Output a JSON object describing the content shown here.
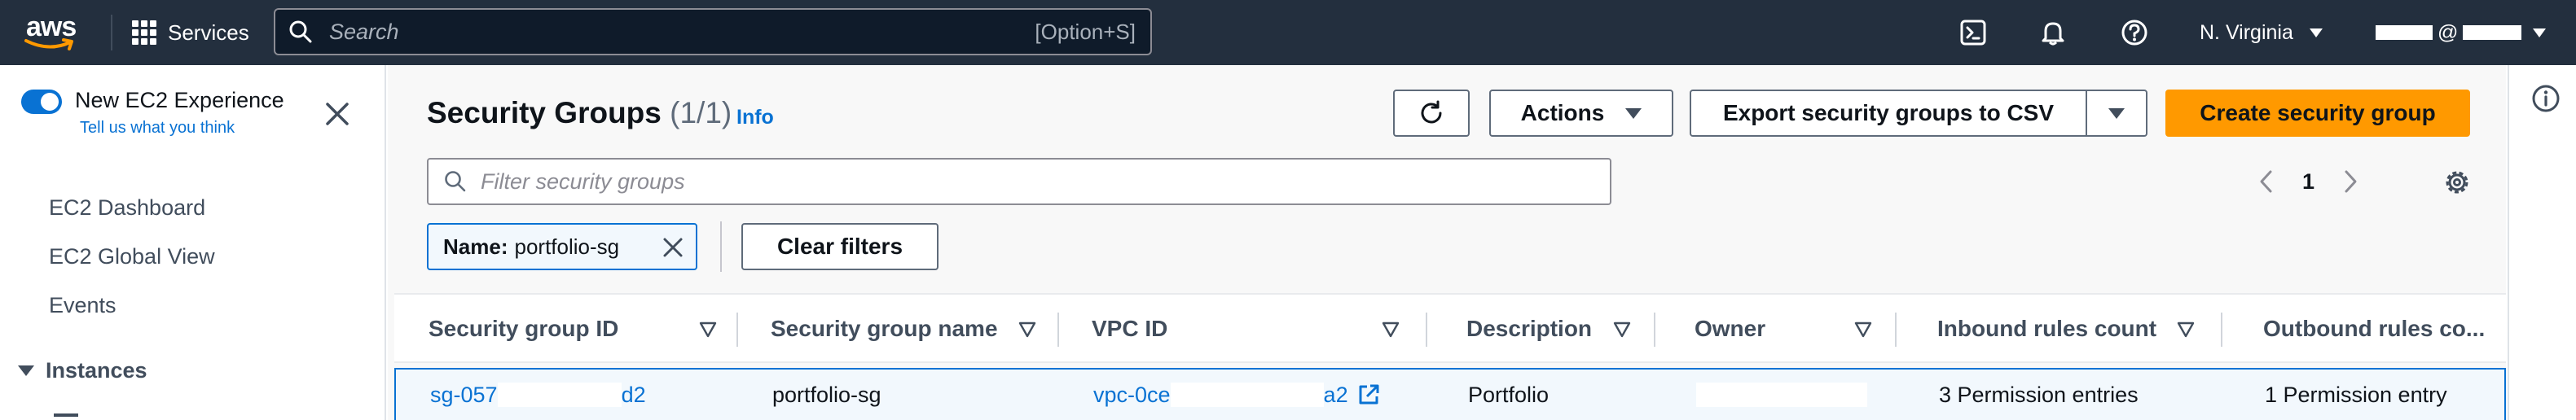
{
  "topnav": {
    "logo_text": "aws",
    "services_label": "Services",
    "search_placeholder": "Search",
    "search_shortcut": "[Option+S]",
    "region_label": "N. Virginia",
    "account_at": "@",
    "icons": [
      "cloudshell-icon",
      "bell-icon",
      "help-icon"
    ]
  },
  "sidenav": {
    "experience_title": "New EC2 Experience",
    "experience_link": "Tell us what you think",
    "items": [
      {
        "label": "EC2 Dashboard"
      },
      {
        "label": "EC2 Global View"
      },
      {
        "label": "Events"
      }
    ],
    "section_label": "Instances"
  },
  "main": {
    "title": "Security Groups",
    "count": "(1/1)",
    "info_label": "Info",
    "actions_label": "Actions",
    "export_label": "Export security groups to CSV",
    "create_label": "Create security group",
    "filter_placeholder": "Filter security groups",
    "page_number": "1",
    "token_key": "Name:",
    "token_value": "portfolio-sg",
    "clear_filters_label": "Clear filters"
  },
  "table": {
    "headers": [
      "Security group ID",
      "Security group name",
      "VPC ID",
      "Description",
      "Owner",
      "Inbound rules count",
      "Outbound rules co..."
    ],
    "row": {
      "sg_id_prefix": "sg-057",
      "sg_id_suffix": "d2",
      "sg_name": "portfolio-sg",
      "vpc_prefix": "vpc-0ce",
      "vpc_suffix": "a2",
      "description": "Portfolio",
      "inbound": "3 Permission entries",
      "outbound": "1 Permission entry"
    }
  },
  "colors": {
    "nav_bg": "#232f3e",
    "link": "#0972d3",
    "primary_button": "#ff9900",
    "selected_row_bg": "#f2f8fd"
  }
}
